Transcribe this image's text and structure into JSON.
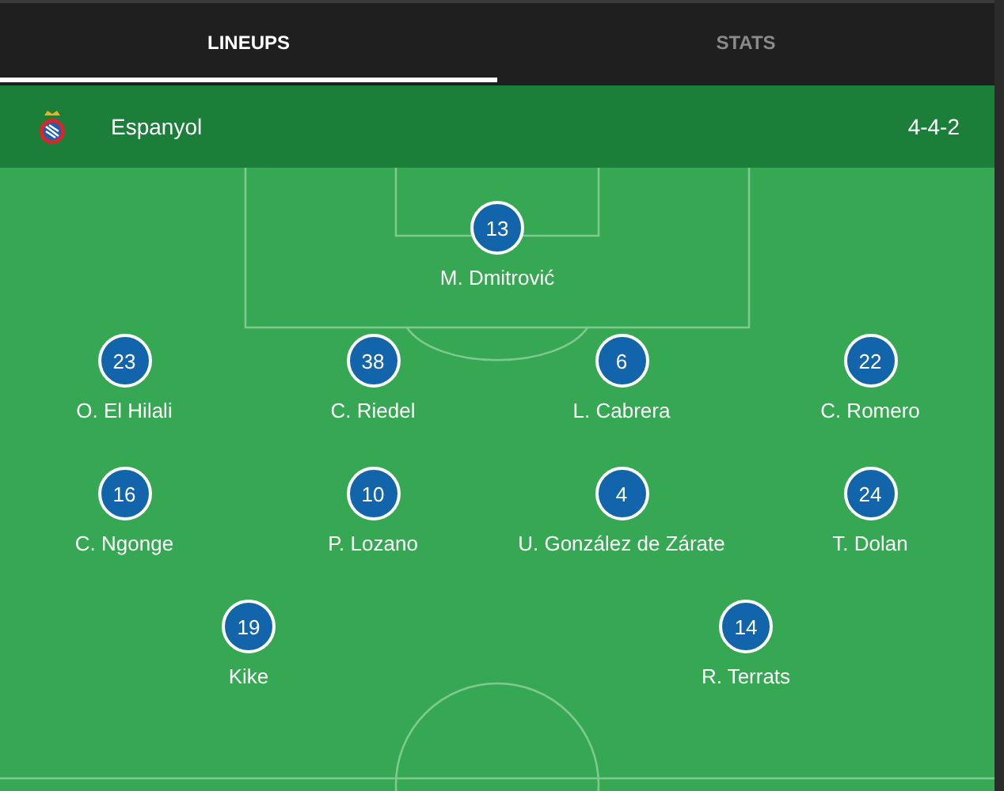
{
  "tabs": [
    {
      "label": "LINEUPS",
      "selected": true
    },
    {
      "label": "STATS",
      "selected": false
    }
  ],
  "team": {
    "name": "Espanyol",
    "formation": "4-4-2"
  },
  "lines": [
    [
      {
        "number": "13",
        "name": "M. Dmitrović"
      }
    ],
    [
      {
        "number": "23",
        "name": "O. El Hilali"
      },
      {
        "number": "38",
        "name": "C. Riedel"
      },
      {
        "number": "6",
        "name": "L. Cabrera"
      },
      {
        "number": "22",
        "name": "C. Romero"
      }
    ],
    [
      {
        "number": "16",
        "name": "C. Ngonge"
      },
      {
        "number": "10",
        "name": "P. Lozano"
      },
      {
        "number": "4",
        "name": "U. González de Zárate"
      },
      {
        "number": "24",
        "name": "T. Dolan"
      }
    ],
    [
      {
        "number": "19",
        "name": "Kike"
      },
      {
        "number": "14",
        "name": "R. Terrats"
      }
    ]
  ]
}
